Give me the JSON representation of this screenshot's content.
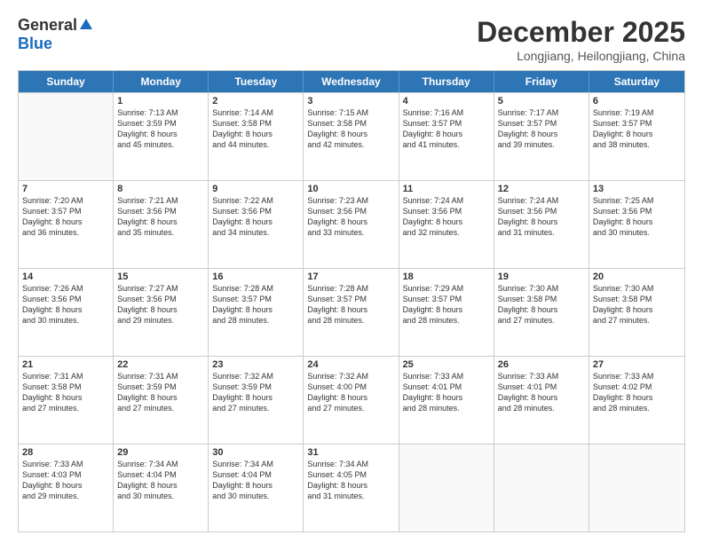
{
  "logo": {
    "general": "General",
    "blue": "Blue"
  },
  "title": "December 2025",
  "subtitle": "Longjiang, Heilongjiang, China",
  "header_days": [
    "Sunday",
    "Monday",
    "Tuesday",
    "Wednesday",
    "Thursday",
    "Friday",
    "Saturday"
  ],
  "weeks": [
    [
      {
        "day": "",
        "text": ""
      },
      {
        "day": "1",
        "text": "Sunrise: 7:13 AM\nSunset: 3:59 PM\nDaylight: 8 hours\nand 45 minutes."
      },
      {
        "day": "2",
        "text": "Sunrise: 7:14 AM\nSunset: 3:58 PM\nDaylight: 8 hours\nand 44 minutes."
      },
      {
        "day": "3",
        "text": "Sunrise: 7:15 AM\nSunset: 3:58 PM\nDaylight: 8 hours\nand 42 minutes."
      },
      {
        "day": "4",
        "text": "Sunrise: 7:16 AM\nSunset: 3:57 PM\nDaylight: 8 hours\nand 41 minutes."
      },
      {
        "day": "5",
        "text": "Sunrise: 7:17 AM\nSunset: 3:57 PM\nDaylight: 8 hours\nand 39 minutes."
      },
      {
        "day": "6",
        "text": "Sunrise: 7:19 AM\nSunset: 3:57 PM\nDaylight: 8 hours\nand 38 minutes."
      }
    ],
    [
      {
        "day": "7",
        "text": "Sunrise: 7:20 AM\nSunset: 3:57 PM\nDaylight: 8 hours\nand 36 minutes."
      },
      {
        "day": "8",
        "text": "Sunrise: 7:21 AM\nSunset: 3:56 PM\nDaylight: 8 hours\nand 35 minutes."
      },
      {
        "day": "9",
        "text": "Sunrise: 7:22 AM\nSunset: 3:56 PM\nDaylight: 8 hours\nand 34 minutes."
      },
      {
        "day": "10",
        "text": "Sunrise: 7:23 AM\nSunset: 3:56 PM\nDaylight: 8 hours\nand 33 minutes."
      },
      {
        "day": "11",
        "text": "Sunrise: 7:24 AM\nSunset: 3:56 PM\nDaylight: 8 hours\nand 32 minutes."
      },
      {
        "day": "12",
        "text": "Sunrise: 7:24 AM\nSunset: 3:56 PM\nDaylight: 8 hours\nand 31 minutes."
      },
      {
        "day": "13",
        "text": "Sunrise: 7:25 AM\nSunset: 3:56 PM\nDaylight: 8 hours\nand 30 minutes."
      }
    ],
    [
      {
        "day": "14",
        "text": "Sunrise: 7:26 AM\nSunset: 3:56 PM\nDaylight: 8 hours\nand 30 minutes."
      },
      {
        "day": "15",
        "text": "Sunrise: 7:27 AM\nSunset: 3:56 PM\nDaylight: 8 hours\nand 29 minutes."
      },
      {
        "day": "16",
        "text": "Sunrise: 7:28 AM\nSunset: 3:57 PM\nDaylight: 8 hours\nand 28 minutes."
      },
      {
        "day": "17",
        "text": "Sunrise: 7:28 AM\nSunset: 3:57 PM\nDaylight: 8 hours\nand 28 minutes."
      },
      {
        "day": "18",
        "text": "Sunrise: 7:29 AM\nSunset: 3:57 PM\nDaylight: 8 hours\nand 28 minutes."
      },
      {
        "day": "19",
        "text": "Sunrise: 7:30 AM\nSunset: 3:58 PM\nDaylight: 8 hours\nand 27 minutes."
      },
      {
        "day": "20",
        "text": "Sunrise: 7:30 AM\nSunset: 3:58 PM\nDaylight: 8 hours\nand 27 minutes."
      }
    ],
    [
      {
        "day": "21",
        "text": "Sunrise: 7:31 AM\nSunset: 3:58 PM\nDaylight: 8 hours\nand 27 minutes."
      },
      {
        "day": "22",
        "text": "Sunrise: 7:31 AM\nSunset: 3:59 PM\nDaylight: 8 hours\nand 27 minutes."
      },
      {
        "day": "23",
        "text": "Sunrise: 7:32 AM\nSunset: 3:59 PM\nDaylight: 8 hours\nand 27 minutes."
      },
      {
        "day": "24",
        "text": "Sunrise: 7:32 AM\nSunset: 4:00 PM\nDaylight: 8 hours\nand 27 minutes."
      },
      {
        "day": "25",
        "text": "Sunrise: 7:33 AM\nSunset: 4:01 PM\nDaylight: 8 hours\nand 28 minutes."
      },
      {
        "day": "26",
        "text": "Sunrise: 7:33 AM\nSunset: 4:01 PM\nDaylight: 8 hours\nand 28 minutes."
      },
      {
        "day": "27",
        "text": "Sunrise: 7:33 AM\nSunset: 4:02 PM\nDaylight: 8 hours\nand 28 minutes."
      }
    ],
    [
      {
        "day": "28",
        "text": "Sunrise: 7:33 AM\nSunset: 4:03 PM\nDaylight: 8 hours\nand 29 minutes."
      },
      {
        "day": "29",
        "text": "Sunrise: 7:34 AM\nSunset: 4:04 PM\nDaylight: 8 hours\nand 30 minutes."
      },
      {
        "day": "30",
        "text": "Sunrise: 7:34 AM\nSunset: 4:04 PM\nDaylight: 8 hours\nand 30 minutes."
      },
      {
        "day": "31",
        "text": "Sunrise: 7:34 AM\nSunset: 4:05 PM\nDaylight: 8 hours\nand 31 minutes."
      },
      {
        "day": "",
        "text": ""
      },
      {
        "day": "",
        "text": ""
      },
      {
        "day": "",
        "text": ""
      }
    ]
  ]
}
